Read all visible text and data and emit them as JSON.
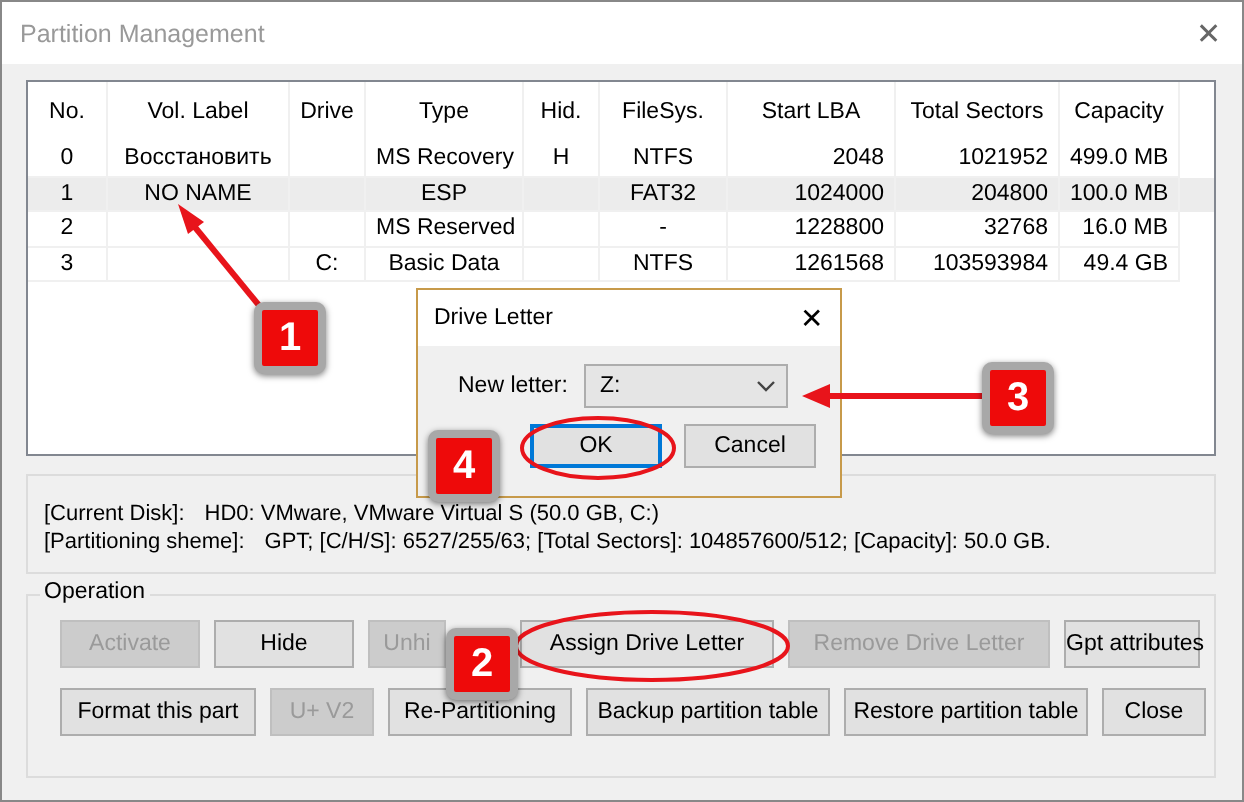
{
  "window": {
    "title": "Partition Management",
    "close": "✕"
  },
  "table": {
    "columns": [
      "No.",
      "Vol. Label",
      "Drive",
      "Type",
      "Hid.",
      "FileSys.",
      "Start LBA",
      "Total Sectors",
      "Capacity"
    ],
    "rows": [
      {
        "cells": [
          "0",
          "Восстановить",
          "",
          "MS Recovery",
          "H",
          "NTFS",
          "2048",
          "1021952",
          "499.0 MB"
        ],
        "selected": false
      },
      {
        "cells": [
          "1",
          "NO NAME",
          "",
          "ESP",
          "",
          "FAT32",
          "1024000",
          "204800",
          "100.0 MB"
        ],
        "selected": true
      },
      {
        "cells": [
          "2",
          "",
          "",
          "MS Reserved",
          "",
          "-",
          "1228800",
          "32768",
          "16.0 MB"
        ],
        "selected": false
      },
      {
        "cells": [
          "3",
          "",
          "C:",
          "Basic Data",
          "",
          "NTFS",
          "1261568",
          "103593984",
          "49.4 GB"
        ],
        "selected": false
      }
    ]
  },
  "disk_info": [
    {
      "label": "[Current Disk]:",
      "value": "HD0: VMware, VMware Virtual S (50.0 GB, C:)"
    },
    {
      "label": "[Partitioning sheme]:",
      "value": "GPT;      [C/H/S]: 6527/255/63; [Total Sectors]: 104857600/512; [Capacity]: 50.0 GB."
    }
  ],
  "operation": {
    "title": "Operation",
    "rows": [
      [
        {
          "label": "Activate",
          "disabled": true
        },
        {
          "label": "Hide",
          "disabled": false
        },
        {
          "label": "Unhi",
          "disabled": true
        },
        {
          "label": "Assign Drive Letter",
          "disabled": false
        },
        {
          "label": "Remove Drive Letter",
          "disabled": true
        },
        {
          "label": "Gpt attributes",
          "disabled": false
        }
      ],
      [
        {
          "label": "Format this part",
          "disabled": false
        },
        {
          "label": "U+ V2",
          "disabled": true
        },
        {
          "label": "Re-Partitioning",
          "disabled": false
        },
        {
          "label": "Backup partition table",
          "disabled": false
        },
        {
          "label": "Restore partition table",
          "disabled": false
        },
        {
          "label": "Close",
          "disabled": false
        }
      ]
    ]
  },
  "dialog": {
    "title": "Drive Letter",
    "close": "✕",
    "field_label": "New letter:",
    "value": "Z:",
    "buttons": [
      {
        "label": "OK",
        "focused": true
      },
      {
        "label": "Cancel",
        "focused": false
      }
    ]
  },
  "callouts": [
    "1",
    "2",
    "3",
    "4"
  ]
}
